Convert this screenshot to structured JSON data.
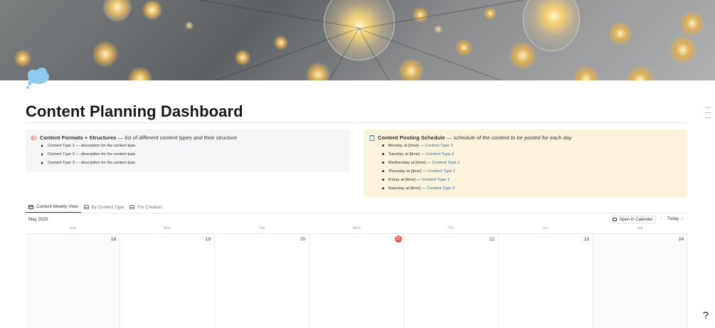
{
  "page": {
    "title": "Content Planning Dashboard",
    "icon": "thought-bubble-icon"
  },
  "colors": {
    "formats_callout_bg": "#f6f5f8",
    "schedule_callout_bg": "#fbf3db",
    "link": "#2b6cb0",
    "today_badge": "#eb5757"
  },
  "formats_callout": {
    "icon": "comedy-masks-icon",
    "title_bold": "Content Formats + Structures",
    "title_sep": " — ",
    "title_italic": "list of different content types and their structure",
    "items": [
      {
        "name": "Content Type 1",
        "sep": " — ",
        "desc": "description for the content type."
      },
      {
        "name": "Content Type 2",
        "sep": " — ",
        "desc": "description for the content type."
      },
      {
        "name": "Content Type 3",
        "sep": " — ",
        "desc": "description for the content type."
      }
    ]
  },
  "schedule_callout": {
    "icon": "notepad-icon",
    "title_bold": "Content Posting Schedule",
    "title_sep": " — ",
    "title_italic": "schedule of the content to be posted for each day",
    "rows": [
      {
        "day": "Monday at [time] — ",
        "link": "Content Type 3"
      },
      {
        "day": "Tuesday at [time] — ",
        "link": "Content Type 2"
      },
      {
        "day": "Wednesday at [time] — ",
        "link": "Content Type 1"
      },
      {
        "day": "Thursday at [time] — ",
        "link": "Content Type 2"
      },
      {
        "day": "Friday at [time] — ",
        "link": "Content Type 1"
      },
      {
        "day": "Saturday at [time] — ",
        "link": "Content Type 3"
      }
    ]
  },
  "tabs": [
    {
      "label": "Content Weekly View",
      "active": true
    },
    {
      "label": "By Content Type",
      "active": false
    },
    {
      "label": "For Creation",
      "active": false
    }
  ],
  "calendar": {
    "month_label": "May 2025",
    "open_button": "Open in Calendar",
    "prev": "‹",
    "today_button": "Today",
    "next": "›",
    "weekdays": [
      "Sun",
      "Mon",
      "Tue",
      "Wed",
      "Thu",
      "Fri",
      "Sat"
    ],
    "days": [
      "18",
      "19",
      "20",
      "21",
      "22",
      "23",
      "24"
    ],
    "today_index": 3
  }
}
